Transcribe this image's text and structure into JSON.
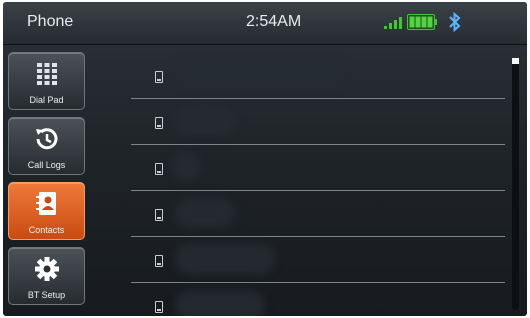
{
  "header": {
    "title": "Phone",
    "time": "2:54AM",
    "signal_icon": "signal-bars-icon",
    "battery_icon": "battery-icon",
    "bluetooth_icon": "bluetooth-icon",
    "accent_green": "#46c23b",
    "bluetooth_color": "#5bb6ff"
  },
  "sidebar": {
    "active_color": "#e2621f",
    "items": [
      {
        "label": "Dial Pad",
        "icon": "dial-pad-icon",
        "active": false
      },
      {
        "label": "Call Logs",
        "icon": "call-logs-icon",
        "active": false
      },
      {
        "label": "Contacts",
        "icon": "contacts-icon",
        "active": true
      },
      {
        "label": "BT Setup",
        "icon": "gear-icon",
        "active": false
      }
    ]
  },
  "contacts": {
    "item_icon": "phone-icon",
    "rows": [
      {
        "name": ""
      },
      {
        "name": ""
      },
      {
        "name": ""
      },
      {
        "name": ""
      },
      {
        "name": ""
      },
      {
        "name": ""
      }
    ]
  },
  "scroll": {
    "position": 0
  }
}
